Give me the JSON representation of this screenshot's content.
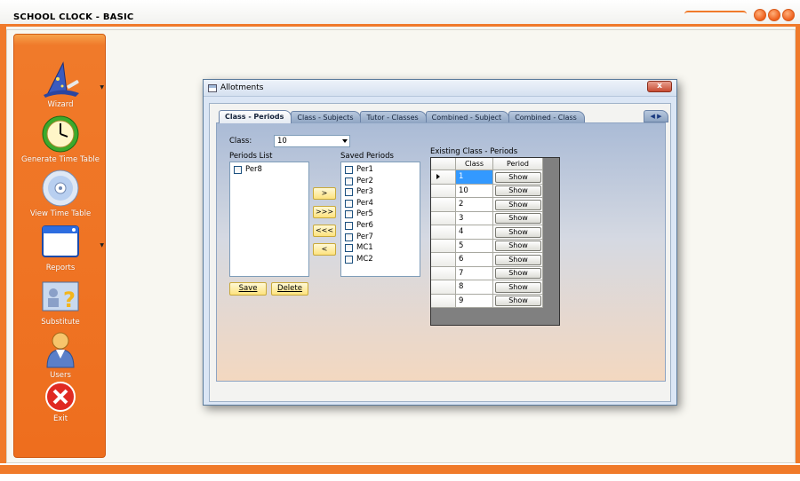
{
  "app": {
    "title": "SCHOOL CLOCK - BASIC"
  },
  "sidebar": {
    "items": [
      {
        "label": "Wizard",
        "icon": "wizard-hat-icon"
      },
      {
        "label": "Generate Time Table",
        "icon": "clock-icon"
      },
      {
        "label": "View Time Table",
        "icon": "disc-icon"
      },
      {
        "label": "Reports",
        "icon": "window-icon"
      },
      {
        "label": "Substitute",
        "icon": "substitute-icon"
      },
      {
        "label": "Users",
        "icon": "user-icon"
      },
      {
        "label": "Exit",
        "icon": "exit-icon"
      }
    ]
  },
  "dialog": {
    "title": "Allotments",
    "close_label": "x",
    "tabs": [
      {
        "label": "Class - Periods",
        "active": true
      },
      {
        "label": "Class - Subjects"
      },
      {
        "label": "Tutor - Classes"
      },
      {
        "label": "Combined - Subject"
      },
      {
        "label": "Combined - Class"
      }
    ],
    "class_label": "Class:",
    "class_value": "10",
    "periods_list_label": "Periods List",
    "periods_list": [
      "Per8"
    ],
    "saved_periods_label": "Saved Periods",
    "saved_periods": [
      "Per1",
      "Per2",
      "Per3",
      "Per4",
      "Per5",
      "Per6",
      "Per7",
      "MC1",
      "MC2"
    ],
    "move_buttons": [
      ">",
      ">>>",
      "<<<",
      "<"
    ],
    "save_label": "Save",
    "delete_label": "Delete",
    "existing_label": "Existing Class - Periods",
    "grid": {
      "headers": [
        "Class",
        "Period"
      ],
      "rows": [
        {
          "class": "1",
          "action": "Show"
        },
        {
          "class": "10",
          "action": "Show"
        },
        {
          "class": "2",
          "action": "Show"
        },
        {
          "class": "3",
          "action": "Show"
        },
        {
          "class": "4",
          "action": "Show"
        },
        {
          "class": "5",
          "action": "Show"
        },
        {
          "class": "6",
          "action": "Show"
        },
        {
          "class": "7",
          "action": "Show"
        },
        {
          "class": "8",
          "action": "Show"
        },
        {
          "class": "9",
          "action": "Show"
        }
      ]
    }
  },
  "colors": {
    "accent": "#f07a2a",
    "selection": "#3399ff"
  }
}
